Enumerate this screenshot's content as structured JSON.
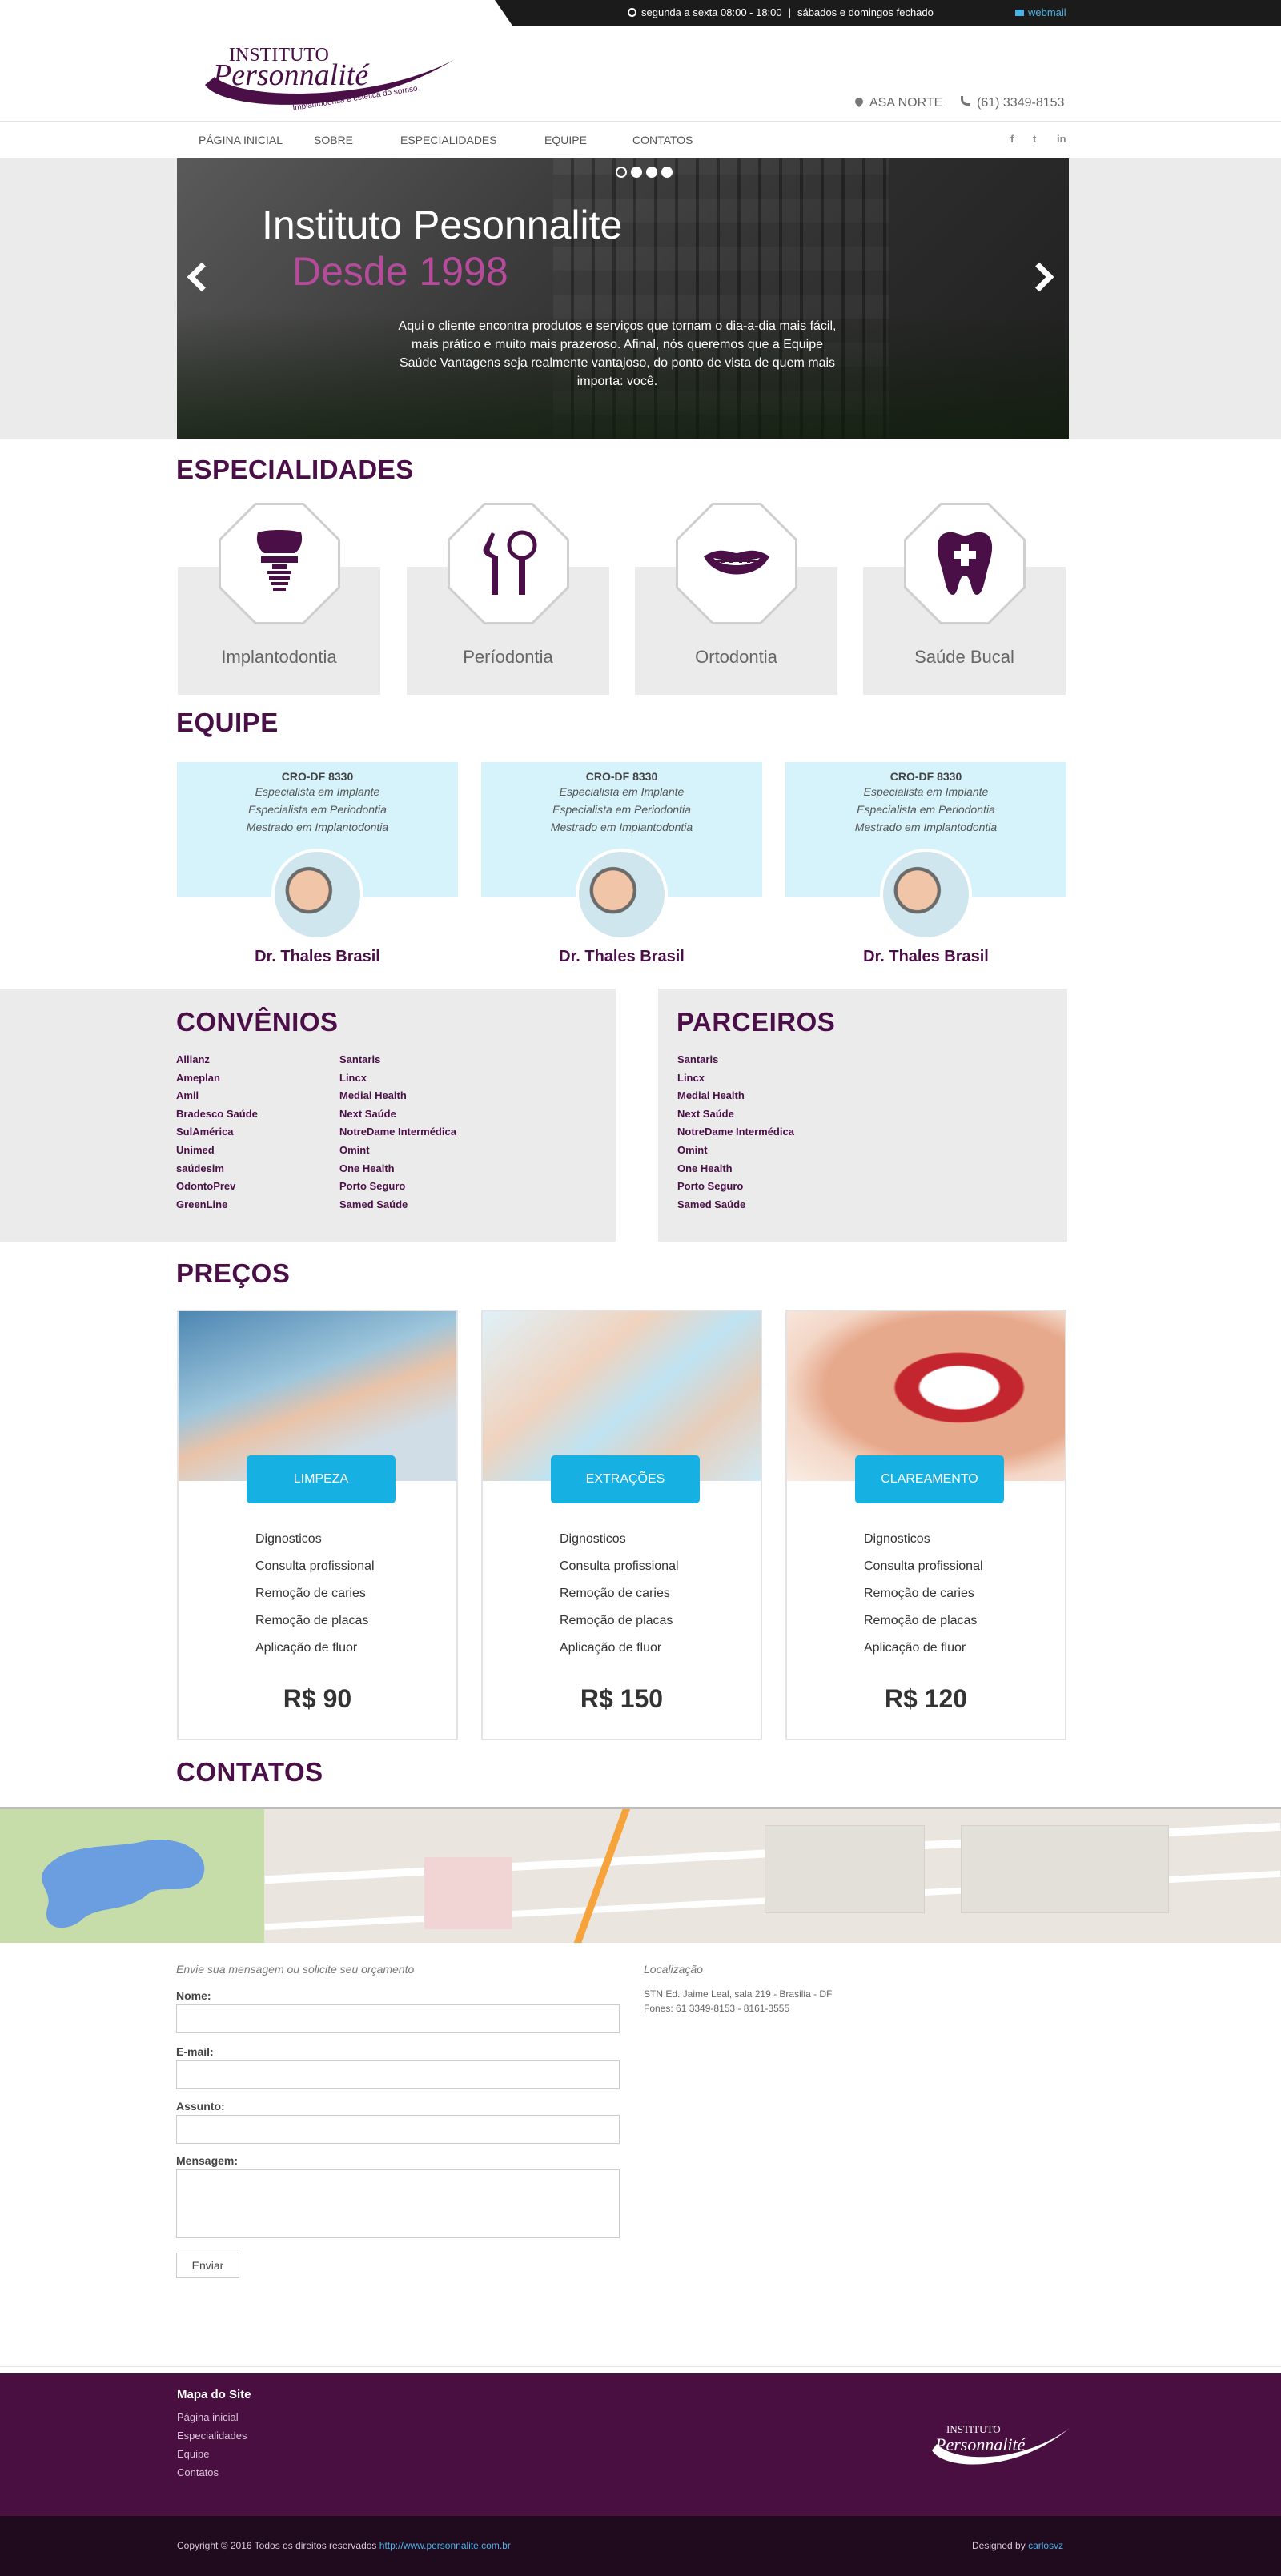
{
  "topbar": {
    "hours_weekdays": "segunda a sexta 08:00 - 18:00",
    "hours_weekend": "sábados e domingos fechado",
    "webmail": "webmail"
  },
  "header": {
    "logo_top": "INSTITUTO",
    "logo_main": "Personnalité",
    "logo_tagline": "Implantodontia e estética do sorriso.",
    "location": "ASA NORTE",
    "phone": "(61) 3349-8153"
  },
  "nav": {
    "items": [
      "PÁGINA INICIAL",
      "SOBRE",
      "ESPECIALIDADES",
      "EQUIPE",
      "CONTATOS"
    ],
    "social": [
      "f",
      "t",
      "in"
    ]
  },
  "slider": {
    "title": "Instituto Pesonnalite",
    "subtitle": "Desde 1998",
    "text": "Aqui o cliente encontra produtos e serviços que tornam o dia-a-dia mais fácil, mais prático e muito mais prazeroso. Afinal, nós queremos que a Equipe Saúde Vantagens seja realmente vantajoso, do ponto de vista de quem mais importa: você."
  },
  "specialties": {
    "title": "ESPECIALIDADES",
    "items": [
      {
        "label": "Implantodontia",
        "icon": "implant-icon"
      },
      {
        "label": "Períodontia",
        "icon": "dental-tools-icon"
      },
      {
        "label": "Ortodontia",
        "icon": "braces-smile-icon"
      },
      {
        "label": "Saúde Bucal",
        "icon": "tooth-cross-icon"
      }
    ]
  },
  "team": {
    "title": "EQUIPE",
    "members": [
      {
        "cro": "CRO-DF 8330",
        "lines": [
          "Especialista em Implante",
          "Especialista em Periodontia",
          "Mestrado em Implantodontia"
        ],
        "name": "Dr. Thales Brasil"
      },
      {
        "cro": "CRO-DF 8330",
        "lines": [
          "Especialista em Implante",
          "Especialista em Periodontia",
          "Mestrado em Implantodontia"
        ],
        "name": "Dr. Thales Brasil"
      },
      {
        "cro": "CRO-DF 8330",
        "lines": [
          "Especialista em Implante",
          "Especialista em Periodontia",
          "Mestrado em Implantodontia"
        ],
        "name": "Dr. Thales Brasil"
      }
    ]
  },
  "convenios": {
    "title": "CONVÊNIOS",
    "col1": [
      "Allianz",
      "Ameplan",
      "Amil",
      "Bradesco Saúde",
      "SulAmérica",
      "Unimed",
      "saúdesim",
      "OdontoPrev",
      "GreenLine"
    ],
    "col2": [
      "Santaris",
      "Lincx",
      "Medial Health",
      "Next Saúde",
      "NotreDame Intermédica",
      "Omint",
      "One Health",
      "Porto Seguro",
      "Samed Saúde"
    ]
  },
  "parceiros": {
    "title": "PARCEIROS",
    "items": [
      "Santaris",
      "Lincx",
      "Medial Health",
      "Next Saúde",
      "NotreDame Intermédica",
      "Omint",
      "One Health",
      "Porto Seguro",
      "Samed Saúde"
    ]
  },
  "prices": {
    "title": "PREÇOS",
    "plans": [
      {
        "name": "LIMPEZA",
        "items": [
          "Dignosticos",
          "Consulta profissional",
          "Remoção de caries",
          "Remoção de placas",
          "Aplicação de fluor"
        ],
        "price": "R$ 90"
      },
      {
        "name": "EXTRAÇÕES",
        "items": [
          "Dignosticos",
          "Consulta profissional",
          "Remoção de caries",
          "Remoção de placas",
          "Aplicação de fluor"
        ],
        "price": "R$ 150"
      },
      {
        "name": "CLAREAMENTO",
        "items": [
          "Dignosticos",
          "Consulta profissional",
          "Remoção de caries",
          "Remoção de placas",
          "Aplicação de fluor"
        ],
        "price": "R$ 120"
      }
    ]
  },
  "contact": {
    "title": "CONTATOS",
    "form_intro": "Envie sua mensagem ou solicite seu orçamento",
    "name_label": "Nome:",
    "email_label": "E-mail:",
    "subject_label": "Assunto:",
    "message_label": "Mensagem:",
    "submit": "Enviar",
    "location_title": "Localização",
    "address": "STN Ed. Jaime Leal, sala 219 - Brasilia - DF",
    "phones": "Fones: 61 3349-8153 - 8161-3555"
  },
  "footer": {
    "sitemap_title": "Mapa do Site",
    "links": [
      "Página inicial",
      "Especialidades",
      "Equipe",
      "Contatos"
    ],
    "logo_top": "INSTITUTO",
    "logo_main": "Personnalité",
    "copyright": "Copyright © 2016 Todos os direitos reservados",
    "url": "http://www.personnalite.com.br",
    "designed_by": "Designed by",
    "designer": "carlosvz"
  },
  "colors": {
    "brand_purple": "#4a0f47",
    "accent_pink": "#b64b9b",
    "accent_blue": "#16b0e3",
    "team_bg": "#d6f3fb"
  }
}
